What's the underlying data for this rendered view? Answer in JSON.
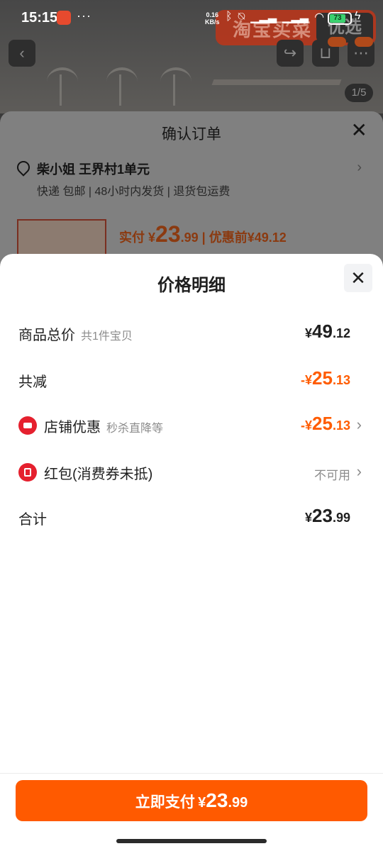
{
  "status_bar": {
    "time": "15:15",
    "more": "···",
    "net_speed_value": "0.16",
    "net_speed_unit": "KB/s",
    "battery": "73"
  },
  "product_bg": {
    "banner_text": "淘宝买菜",
    "banner_right": "优选",
    "image_counter": "1/5"
  },
  "order": {
    "title": "确认订单",
    "address": "柴小姐 王界村1单元",
    "tags": "快递 包邮 | 48小时内发货 | 退货包运费",
    "pay_prefix": "实付 ¥",
    "pay_int": "23",
    "pay_dec": ".99",
    "before_discount": "| 优惠前¥49.12"
  },
  "sheet": {
    "title": "价格明细",
    "rows": [
      {
        "label": "商品总价",
        "sub": "共1件宝贝",
        "symbol": "¥",
        "int": "49",
        "dec": ".12"
      },
      {
        "label": "共减",
        "symbol": "-¥",
        "int": "25",
        "dec": ".13"
      },
      {
        "label": "店铺优惠",
        "sub": "秒杀直降等",
        "symbol": "-¥",
        "int": "25",
        "dec": ".13"
      },
      {
        "label": "红包(消费券未抵)",
        "status": "不可用"
      },
      {
        "label": "合计",
        "symbol": "¥",
        "int": "23",
        "dec": ".99"
      }
    ]
  },
  "pay_button": {
    "label": "立即支付",
    "symbol": "¥",
    "int": "23",
    "dec": ".99"
  },
  "colors": {
    "accent": "#ff5a00",
    "discount": "#ff5c00",
    "icon_red": "#e5202e"
  }
}
